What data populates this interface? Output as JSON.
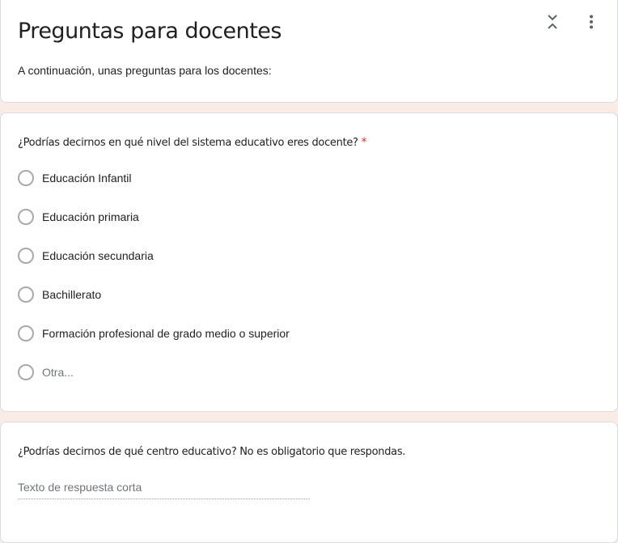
{
  "section": {
    "title": "Preguntas para docentes",
    "description": "A continuación, unas preguntas para los docentes:"
  },
  "question1": {
    "title": "¿Podrías decirnos en qué nivel del sistema educativo eres docente?",
    "required_marker": "*",
    "options": [
      {
        "label": "Educación Infantil"
      },
      {
        "label": "Educación primaria"
      },
      {
        "label": "Educación secundaria"
      },
      {
        "label": "Bachillerato"
      },
      {
        "label": "Formación profesional de grado medio o superior"
      },
      {
        "label": "Otra..."
      }
    ]
  },
  "question2": {
    "title": "¿Podrías decirnos de qué centro educativo? No es obligatorio que respondas.",
    "placeholder": "Texto de respuesta corta"
  },
  "colors": {
    "background": "#f9ebe6",
    "required": "#d93025"
  },
  "icons": {
    "collapse": "unfold-less-icon",
    "more": "more-vert-icon"
  }
}
